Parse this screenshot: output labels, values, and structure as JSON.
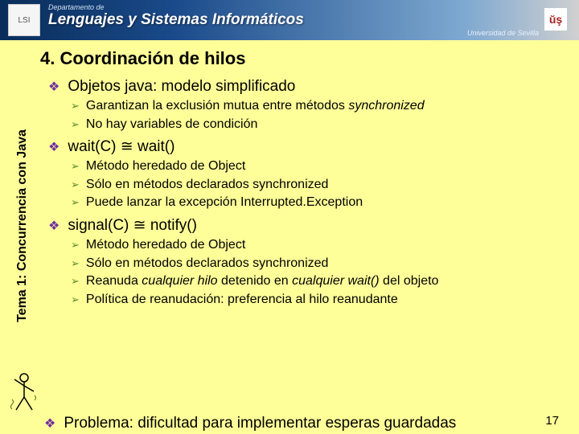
{
  "header": {
    "pretitle": "Departamento de",
    "title": "Lenguajes y Sistemas Informáticos",
    "subtitle": "Universidad de Sevilla",
    "logo1": "LSI",
    "logo2": "ŭş"
  },
  "slide_title": "4. Coordinación de hilos",
  "sidebar_text": "Tema 1: Concurrencia con Java",
  "bullets": [
    {
      "text": "Objetos java: modelo simplificado",
      "subs": [
        {
          "pre": "Garantizan la exclusión mutua entre métodos ",
          "em": "synchronized",
          "post": ""
        },
        {
          "pre": "No hay variables de condición",
          "em": "",
          "post": ""
        }
      ]
    },
    {
      "text": "wait(C) ≅ wait()",
      "subs": [
        {
          "pre": "Método heredado de Object",
          "em": "",
          "post": ""
        },
        {
          "pre": "Sólo en métodos declarados synchronized",
          "em": "",
          "post": ""
        },
        {
          "pre": "Puede lanzar la excepción Interrupted.Exception",
          "em": "",
          "post": ""
        }
      ]
    },
    {
      "text": "signal(C) ≅ notify()",
      "subs": [
        {
          "pre": "Método heredado de Object",
          "em": "",
          "post": ""
        },
        {
          "pre": "Sólo en métodos declarados synchronized",
          "em": "",
          "post": ""
        },
        {
          "pre": "Reanuda ",
          "em": "cualquier hilo",
          "post": " detenido en ",
          "em2": "cualquier wait()",
          "post2": " del objeto"
        },
        {
          "pre": "Política de reanudación: preferencia al hilo reanudante",
          "em": "",
          "post": ""
        }
      ]
    }
  ],
  "problem": {
    "label": "Problema: ",
    "text": "dificultad para implementar esperas guardadas"
  },
  "page_number": "17"
}
